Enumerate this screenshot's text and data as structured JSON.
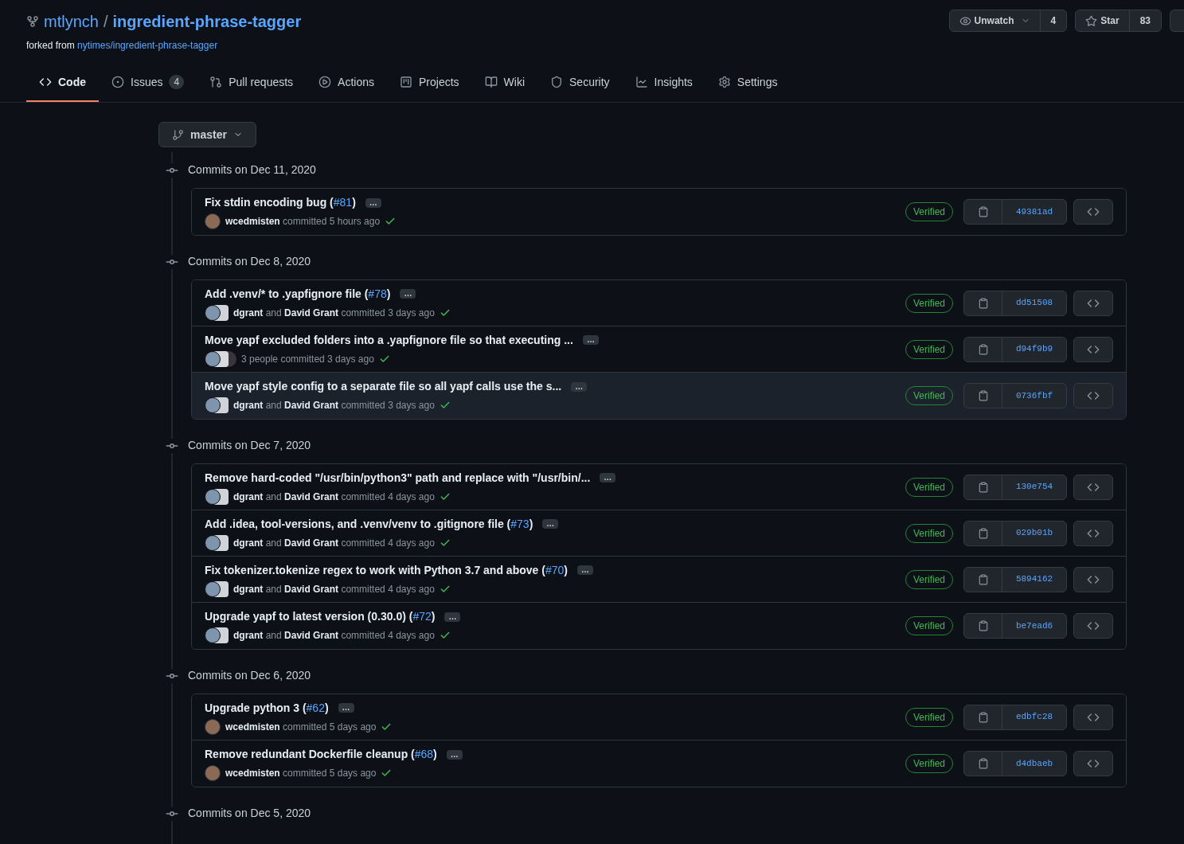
{
  "repo": {
    "owner": "mtlynch",
    "separator": "/",
    "name": "ingredient-phrase-tagger",
    "forked_prefix": "forked from",
    "forked_from": "nytimes/ingredient-phrase-tagger"
  },
  "actions": [
    {
      "kind": "watch",
      "label": "Unwatch",
      "count": "4"
    },
    {
      "kind": "star",
      "label": "Star",
      "count": "83"
    }
  ],
  "tabs": [
    {
      "kind": "code",
      "label": "Code",
      "selected": true
    },
    {
      "kind": "issues",
      "label": "Issues",
      "count": "4",
      "selected": false
    },
    {
      "kind": "pulls",
      "label": "Pull requests",
      "selected": false
    },
    {
      "kind": "actions",
      "label": "Actions",
      "selected": false
    },
    {
      "kind": "projects",
      "label": "Projects",
      "selected": false
    },
    {
      "kind": "wiki",
      "label": "Wiki",
      "selected": false
    },
    {
      "kind": "security",
      "label": "Security",
      "selected": false
    },
    {
      "kind": "insights",
      "label": "Insights",
      "selected": false
    },
    {
      "kind": "settings",
      "label": "Settings",
      "selected": false
    }
  ],
  "branch": {
    "label": "master"
  },
  "groups": [
    {
      "heading": "Commits on Dec 11, 2020",
      "commits": [
        {
          "title": "Fix stdin encoding bug (",
          "pr": "#81",
          "title_end": ")",
          "more": "…",
          "kind": "single",
          "author": "wcedmisten",
          "verb": "committed",
          "time": "5 hours ago",
          "badge": "Verified",
          "sha": "49381ad",
          "highlighted": false
        }
      ]
    },
    {
      "heading": "Commits on Dec 8, 2020",
      "commits": [
        {
          "title": "Add .venv/* to .yapfignore file (",
          "pr": "#78",
          "title_end": ")",
          "more": "…",
          "kind": "pair",
          "author": "dgrant",
          "connector": "and",
          "coauthor": "David Grant",
          "verb": "committed",
          "time": "3 days ago",
          "badge": "Verified",
          "sha": "dd51508",
          "highlighted": false
        },
        {
          "title": "Move yapf excluded folders into a .yapfignore file so that executing ...",
          "more": "…",
          "kind": "group",
          "people": "3 people",
          "verb": "committed",
          "time": "3 days ago",
          "badge": "Verified",
          "sha": "d94f9b9",
          "highlighted": false
        },
        {
          "title": "Move yapf style config to a separate file so all yapf calls use the s...",
          "more": "…",
          "kind": "pair",
          "author": "dgrant",
          "connector": "and",
          "coauthor": "David Grant",
          "verb": "committed",
          "time": "3 days ago",
          "badge": "Verified",
          "sha": "0736fbf",
          "highlighted": true
        }
      ]
    },
    {
      "heading": "Commits on Dec 7, 2020",
      "commits": [
        {
          "title": "Remove hard-coded \"/usr/bin/python3\" path and replace with \"/usr/bin/...",
          "more": "…",
          "kind": "pair",
          "author": "dgrant",
          "connector": "and",
          "coauthor": "David Grant",
          "verb": "committed",
          "time": "4 days ago",
          "badge": "Verified",
          "sha": "130e754",
          "highlighted": false
        },
        {
          "title": "Add .idea, tool-versions, and .venv/venv to .gitignore file (",
          "pr": "#73",
          "title_end": ")",
          "more": "…",
          "kind": "pair",
          "author": "dgrant",
          "connector": "and",
          "coauthor": "David Grant",
          "verb": "committed",
          "time": "4 days ago",
          "badge": "Verified",
          "sha": "029b01b",
          "highlighted": false
        },
        {
          "title": "Fix tokenizer.tokenize regex to work with Python 3.7 and above (",
          "pr": "#70",
          "title_end": ")",
          "more": "…",
          "kind": "pair",
          "author": "dgrant",
          "connector": "and",
          "coauthor": "David Grant",
          "verb": "committed",
          "time": "4 days ago",
          "badge": "Verified",
          "sha": "5894162",
          "highlighted": false
        },
        {
          "title": "Upgrade yapf to latest version (0.30.0) (",
          "pr": "#72",
          "title_end": ")",
          "more": "…",
          "kind": "pair",
          "author": "dgrant",
          "connector": "and",
          "coauthor": "David Grant",
          "verb": "committed",
          "time": "4 days ago",
          "badge": "Verified",
          "sha": "be7ead6",
          "highlighted": false
        }
      ]
    },
    {
      "heading": "Commits on Dec 6, 2020",
      "commits": [
        {
          "title": "Upgrade python 3 (",
          "pr": "#62",
          "title_end": ")",
          "more": "…",
          "kind": "single",
          "author": "wcedmisten",
          "verb": "committed",
          "time": "5 days ago",
          "badge": "Verified",
          "sha": "edbfc28",
          "highlighted": false
        },
        {
          "title": "Remove redundant Dockerfile cleanup (",
          "pr": "#68",
          "title_end": ")",
          "more": "…",
          "kind": "single",
          "author": "wcedmisten",
          "verb": "committed",
          "time": "5 days ago",
          "badge": "Verified",
          "sha": "d4dbaeb",
          "highlighted": false
        }
      ]
    },
    {
      "heading": "Commits on Dec 5, 2020"
    }
  ]
}
